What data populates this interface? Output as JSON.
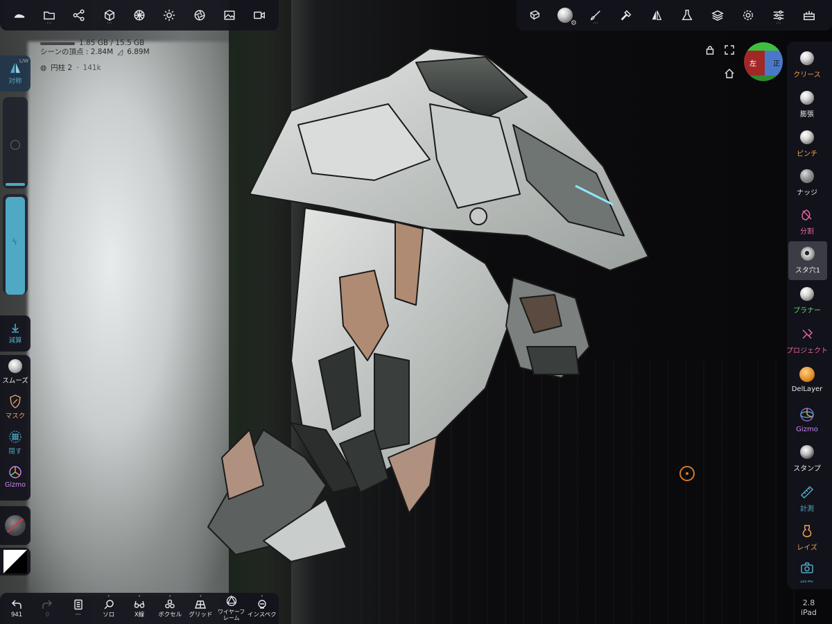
{
  "colors": {
    "panel_bg": "#14141c",
    "accent_cyan": "#4fa9c5",
    "label_orange": "#f0a050",
    "label_pink": "#e8679a",
    "label_green": "#6fd46f",
    "label_purple": "#c88af0",
    "label_white": "#e8e8ec",
    "pivot_orange": "#d47a2a"
  },
  "top_left_toolbar": {
    "items": [
      {
        "icon": "nomad-logo-icon"
      },
      {
        "icon": "folder-icon",
        "has_more": true
      },
      {
        "icon": "scene-graph-icon"
      },
      {
        "icon": "primitive-shape-icon",
        "has_more": true
      },
      {
        "icon": "material-sphere-icon"
      },
      {
        "icon": "light-sun-icon"
      },
      {
        "icon": "camera-aperture-icon"
      },
      {
        "icon": "image-icon"
      },
      {
        "icon": "video-camera-icon"
      }
    ]
  },
  "top_right_toolbar": {
    "items": [
      {
        "icon": "multi-mesh-icon"
      },
      {
        "icon": "selected-material-icon"
      },
      {
        "icon": "paint-brush-icon",
        "has_more": true
      },
      {
        "icon": "hammer-icon"
      },
      {
        "icon": "symmetry-triangle-icon"
      },
      {
        "icon": "flask-icon"
      },
      {
        "icon": "layers-icon"
      },
      {
        "icon": "settings-gear-icon"
      },
      {
        "icon": "sliders-icon",
        "has_more": true
      },
      {
        "icon": "toolbox-icon"
      }
    ]
  },
  "scene_info": {
    "memory": "1.85 GB / 15.5 GB",
    "vertices": "シーンの頂点 : 2.84M",
    "faces": "6.89M",
    "mesh_name": "円柱 2",
    "mesh_count": "141k"
  },
  "left_panel": {
    "symmetry_label": "対称",
    "symmetry_sub": "L/W",
    "radius_level": 0.0,
    "intensity_level": 0.98,
    "subtract_label": "減算",
    "smooth_label": "スムーズ",
    "mask_label": "マスク",
    "hide_label": "隠す",
    "gizmo_label": "Gizmo"
  },
  "right_panel": {
    "tools": [
      {
        "label": "クリース",
        "icon": "crease-ball-icon",
        "color": "#f0a050"
      },
      {
        "label": "膨張",
        "icon": "inflate-ball-icon",
        "color": "#e8e8ec"
      },
      {
        "label": "ピンチ",
        "icon": "pinch-ball-icon",
        "color": "#f0a050"
      },
      {
        "label": "ナッジ",
        "icon": "nudge-ball-icon",
        "color": "#e8e8ec"
      },
      {
        "label": "分割",
        "icon": "split-icon",
        "color": "#e8679a"
      },
      {
        "label": "スタ穴1",
        "icon": "stamp-hole-ball-icon",
        "color": "#e8e8ec",
        "active": true
      },
      {
        "label": "プラナー",
        "icon": "planar-ball-icon",
        "color": "#6fd46f"
      },
      {
        "label": "プロジェクト",
        "icon": "project-icon",
        "color": "#e8679a"
      },
      {
        "label": "DelLayer",
        "icon": "del-layer-icon",
        "color": "#e8e8ec"
      },
      {
        "label": "Gizmo",
        "icon": "gizmo-icon",
        "color": "#c88af0"
      },
      {
        "label": "スタンプ",
        "icon": "stamp-ball-icon",
        "color": "#e8e8ec"
      },
      {
        "label": "計測",
        "icon": "ruler-icon",
        "color": "#4fa9c5"
      },
      {
        "label": "レイズ",
        "icon": "raise-icon",
        "color": "#f0a050"
      },
      {
        "label": "撮影",
        "icon": "camera-icon",
        "color": "#4fa9c5"
      }
    ]
  },
  "view_gizmo": {
    "left_face": "左",
    "right_face": "正"
  },
  "bottom_bar": {
    "items": [
      {
        "label": "941",
        "icon": "undo-icon"
      },
      {
        "label": "0",
        "icon": "redo-icon"
      },
      {
        "label": "···",
        "icon": "document-icon"
      },
      {
        "label": "ソロ",
        "icon": "magnifier-icon",
        "dot": true
      },
      {
        "label": "X線",
        "icon": "xray-glasses-icon",
        "dot": true
      },
      {
        "label": "ボクセル",
        "icon": "voxel-icon",
        "dot": true
      },
      {
        "label": "グリッド",
        "icon": "grid-icon",
        "dot": true
      },
      {
        "label": "ワイヤーフレーム",
        "icon": "wireframe-icon",
        "dot": true
      },
      {
        "label": "インスペクタ",
        "icon": "inspector-icon",
        "dot": true
      }
    ]
  },
  "version": {
    "number": "2.8",
    "device": "iPad"
  }
}
